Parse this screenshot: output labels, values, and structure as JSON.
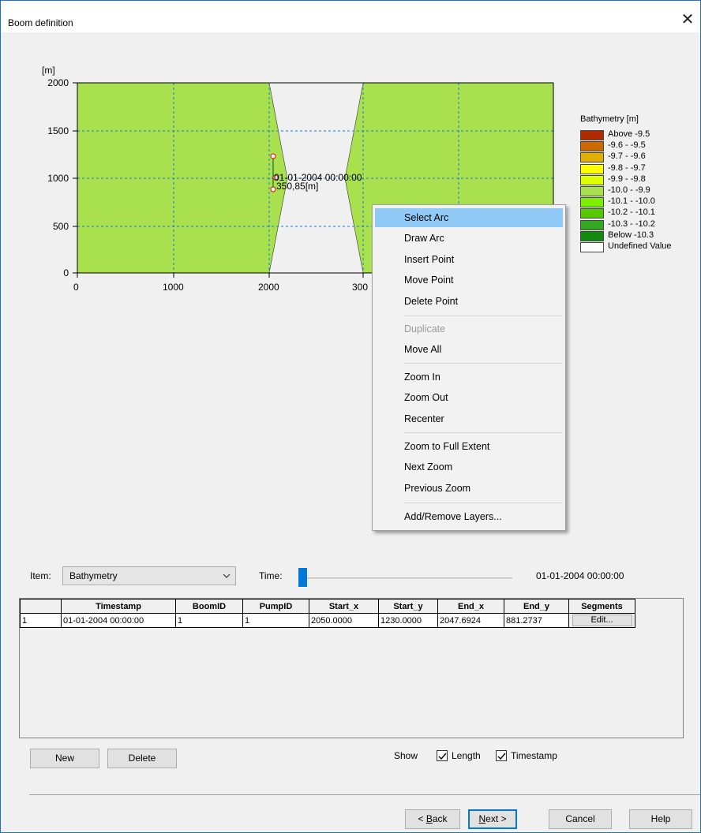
{
  "window": {
    "title": "Boom definition",
    "close_glyph": "✕"
  },
  "map": {
    "y_unit": "[m]",
    "y_ticks": [
      "2000",
      "1500",
      "1000",
      "500",
      "0"
    ],
    "x_ticks": [
      "0",
      "1000",
      "2000",
      "300"
    ],
    "overlay_timestamp": "01-01-2004 00:00:00",
    "overlay_length": "350,85[m]",
    "land_color": "#a8e04e",
    "water_color": "#f0f0f0"
  },
  "legend": {
    "title": "Bathymetry [m]",
    "items": [
      {
        "label": "Above  -9.5",
        "color": "#b22a00"
      },
      {
        "label": "-9.6 -  -9.5",
        "color": "#cc6a00"
      },
      {
        "label": "-9.7 -  -9.6",
        "color": "#e0b000"
      },
      {
        "label": "-9.8 -  -9.7",
        "color": "#ffff00"
      },
      {
        "label": "-9.9 -  -9.8",
        "color": "#ddff00"
      },
      {
        "label": "-10.0 -  -9.9",
        "color": "#a8e04e"
      },
      {
        "label": "-10.1 - -10.0",
        "color": "#7cee00"
      },
      {
        "label": "-10.2 - -10.1",
        "color": "#55c800"
      },
      {
        "label": "-10.3 - -10.2",
        "color": "#33a820"
      },
      {
        "label": "Below  -10.3",
        "color": "#118a10"
      },
      {
        "label": "Undefined Value",
        "color": "#ffffff"
      }
    ]
  },
  "context_menu": {
    "items": [
      {
        "label": "Select Arc"
      },
      {
        "label": "Draw Arc"
      },
      {
        "label": "Insert Point"
      },
      {
        "label": "Move Point"
      },
      {
        "label": "Delete Point"
      },
      {
        "label": "Duplicate"
      },
      {
        "label": "Move All"
      },
      {
        "label": "Zoom In"
      },
      {
        "label": "Zoom Out"
      },
      {
        "label": "Recenter"
      },
      {
        "label": "Zoom to Full Extent"
      },
      {
        "label": "Next Zoom"
      },
      {
        "label": "Previous Zoom"
      },
      {
        "label": "Add/Remove Layers..."
      }
    ]
  },
  "controls": {
    "item_label": "Item:",
    "item_value": "Bathymetry",
    "time_label": "Time:",
    "time_value": "01-01-2004 00:00:00"
  },
  "table": {
    "headers": [
      "Timestamp",
      "BoomID",
      "PumpID",
      "Start_x",
      "Start_y",
      "End_x",
      "End_y",
      "Segments"
    ],
    "rows": [
      {
        "index": "1",
        "timestamp": "01-01-2004 00:00:00",
        "boomid": "1",
        "pumpid": "1",
        "start_x": "2050.0000",
        "start_y": "1230.0000",
        "end_x": "2047.6924",
        "end_y": "881.2737",
        "segments": "Edit..."
      }
    ]
  },
  "buttons": {
    "new": "New",
    "delete": "Delete",
    "back_prefix": "< ",
    "back_key": "B",
    "back_rest": "ack",
    "next_key": "N",
    "next_rest": "ext >",
    "cancel": "Cancel",
    "help": "Help"
  },
  "show": {
    "label": "Show",
    "length_label": "Length",
    "length_checked": true,
    "timestamp_label": "Timestamp",
    "timestamp_checked": true
  }
}
